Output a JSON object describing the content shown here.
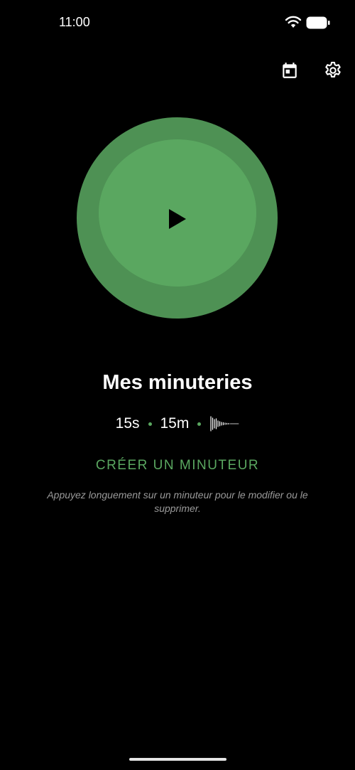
{
  "status_bar": {
    "time": "11:00",
    "icons": [
      "wifi-icon",
      "battery-icon"
    ]
  },
  "toolbar": {
    "icons": [
      "calendar-icon",
      "gear-icon"
    ]
  },
  "timer": {
    "icon": "play-icon",
    "colors": {
      "outer": "#4e9154",
      "inner": "#5aa760"
    }
  },
  "main": {
    "title": "Mes minuteries",
    "presets": [
      "15s",
      "15m"
    ],
    "preset_icon": "sound-wave-icon",
    "create_label": "CRÉER UN MINUTEUR",
    "hint": "Appuyez longuement sur un minuteur pour le modifier ou le supprimer."
  },
  "colors": {
    "accent": "#5aa760",
    "background": "#000000",
    "hint": "#9a9a9a"
  }
}
